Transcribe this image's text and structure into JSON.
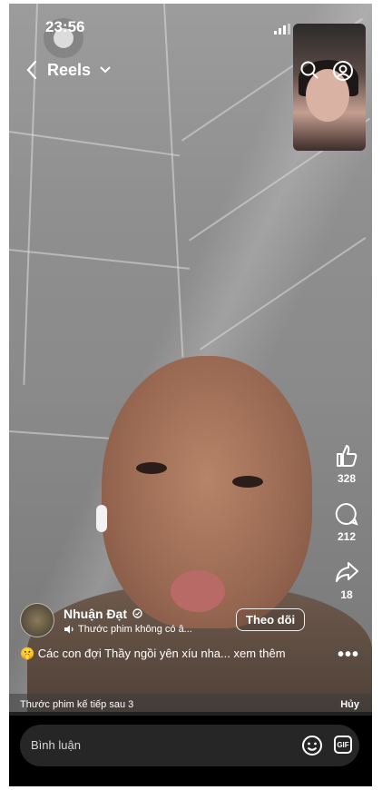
{
  "status": {
    "time": "23:56"
  },
  "header": {
    "title": "Reels"
  },
  "rail": {
    "likes": "328",
    "comments": "212",
    "shares": "18"
  },
  "author": {
    "name": "Nhuận Đạt",
    "audio": "Thước phim không có â...",
    "follow_label": "Theo dõi"
  },
  "caption": {
    "text": "🤫 Các con đợi Thầy ngồi yên xíu nha... xem thêm"
  },
  "next_bar": {
    "label": "Thước phim kế tiếp sau 3",
    "cancel": "Hủy"
  },
  "comment": {
    "placeholder": "Bình luận",
    "gif_label": "GIF"
  },
  "icons": [
    "back-icon",
    "chevron-down-icon",
    "search-icon",
    "profile-icon",
    "like-icon",
    "comment-icon",
    "share-icon",
    "more-icon",
    "emoji-icon",
    "gif-icon",
    "audio-icon"
  ]
}
